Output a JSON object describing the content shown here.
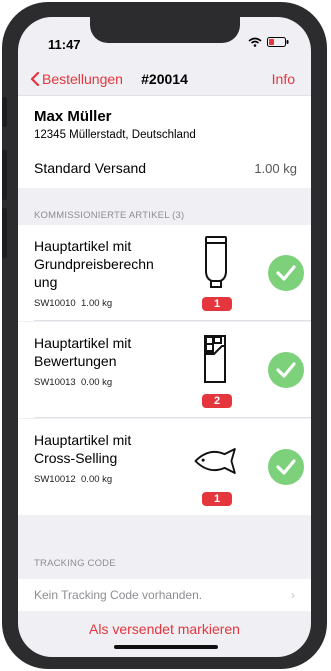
{
  "status": {
    "time": "11:47"
  },
  "nav": {
    "back_label": "Bestellungen",
    "title": "#20014",
    "info_label": "Info"
  },
  "customer": {
    "name": "Max Müller",
    "address": "12345 Müllerstadt, Deutschland"
  },
  "shipping": {
    "method": "Standard Versand",
    "weight": "1.00 kg"
  },
  "articles_section": {
    "header": "KOMMISSIONIERTE ARTIKEL (3)"
  },
  "articles": [
    {
      "title": "Hauptartikel mit Grundpreisberechn ung",
      "sku": "SW10010",
      "weight": "1.00 kg",
      "quantity": "1",
      "icon": "tube-icon",
      "picked": true
    },
    {
      "title": "Hauptartikel mit Bewertungen",
      "sku": "SW10013",
      "weight": "0.00 kg",
      "quantity": "2",
      "icon": "chocolate-icon",
      "picked": true
    },
    {
      "title": "Hauptartikel mit Cross-Selling",
      "sku": "SW10012",
      "weight": "0.00 kg",
      "quantity": "1",
      "icon": "fish-icon",
      "picked": true
    }
  ],
  "tracking": {
    "header": "TRACKING CODE",
    "value": "Kein Tracking Code vorhanden."
  },
  "actions": {
    "mark_shipped": "Als versendet markieren"
  },
  "colors": {
    "accent": "#e5363d",
    "check": "#7cd17a",
    "background": "#efeff4"
  }
}
